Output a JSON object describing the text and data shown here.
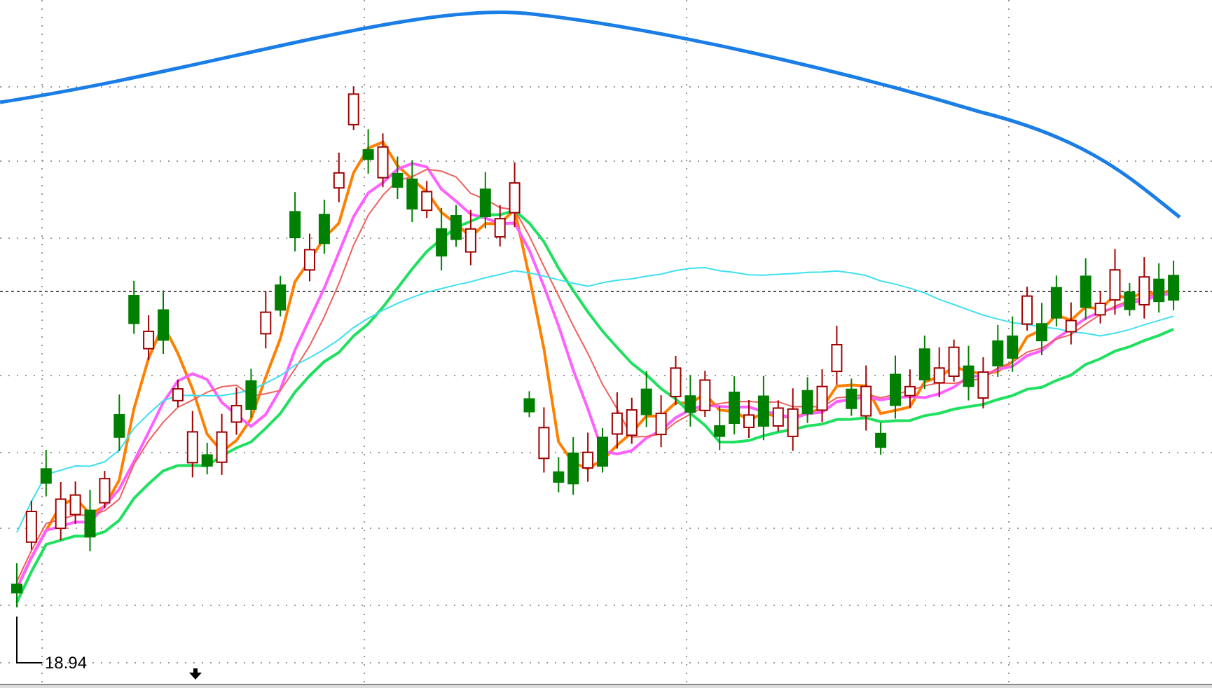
{
  "chart": {
    "low_label": "18.94"
  }
}
